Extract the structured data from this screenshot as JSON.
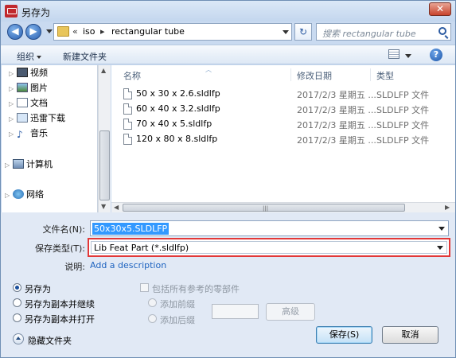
{
  "window": {
    "title": "另存为",
    "close_label": "✕"
  },
  "nav": {
    "back": "◀",
    "forward": "▶",
    "address": {
      "chevron": "«",
      "parts": [
        "iso",
        "rectangular tube"
      ],
      "separator": "▸"
    },
    "refresh": "↻",
    "search_placeholder": "搜索 rectangular tube"
  },
  "toolbar": {
    "organize": "组织",
    "new_folder": "新建文件夹",
    "help": "?"
  },
  "sidebar": {
    "items": [
      {
        "label": "视频",
        "icon": "video-icon"
      },
      {
        "label": "图片",
        "icon": "picture-icon"
      },
      {
        "label": "文档",
        "icon": "document-icon"
      },
      {
        "label": "迅雷下载",
        "icon": "download-icon"
      },
      {
        "label": "音乐",
        "icon": "music-icon"
      },
      {
        "label": "计算机",
        "icon": "computer-icon"
      },
      {
        "label": "网络",
        "icon": "network-icon"
      }
    ]
  },
  "columns": {
    "name": "名称",
    "date": "修改日期",
    "type": "类型"
  },
  "files": [
    {
      "name": "50 x 30 x 2.6.sldlfp",
      "date": "2017/2/3 星期五 ...",
      "type": "SLDLFP 文件"
    },
    {
      "name": "60 x 40 x 3.2.sldlfp",
      "date": "2017/2/3 星期五 ...",
      "type": "SLDLFP 文件"
    },
    {
      "name": "70 x 40 x 5.sldlfp",
      "date": "2017/2/3 星期五 ...",
      "type": "SLDLFP 文件"
    },
    {
      "name": "120 x 80 x 8.sldlfp",
      "date": "2017/2/3 星期五 ...",
      "type": "SLDLFP 文件"
    }
  ],
  "form": {
    "filename_label": "文件名(N):",
    "filename_value": "50x30x5.SLDLFP",
    "filetype_label": "保存类型(T):",
    "filetype_value": "Lib Feat Part (*.sldlfp)",
    "description_label": "说明:",
    "description_link": "Add a description"
  },
  "options": {
    "save_as": "另存为",
    "save_copy_continue": "另存为副本并继续",
    "save_copy_open": "另存为副本并打开",
    "include_refs": "包括所有参考的零部件",
    "add_prefix": "添加前缀",
    "add_suffix": "添加后缀",
    "advanced": "高级"
  },
  "buttons": {
    "save": "保存(S)",
    "cancel": "取消",
    "hide_folders": "隐藏文件夹"
  },
  "colors": {
    "accent": "#3399ff",
    "highlight_border": "#e23838",
    "link": "#1f64c0"
  }
}
